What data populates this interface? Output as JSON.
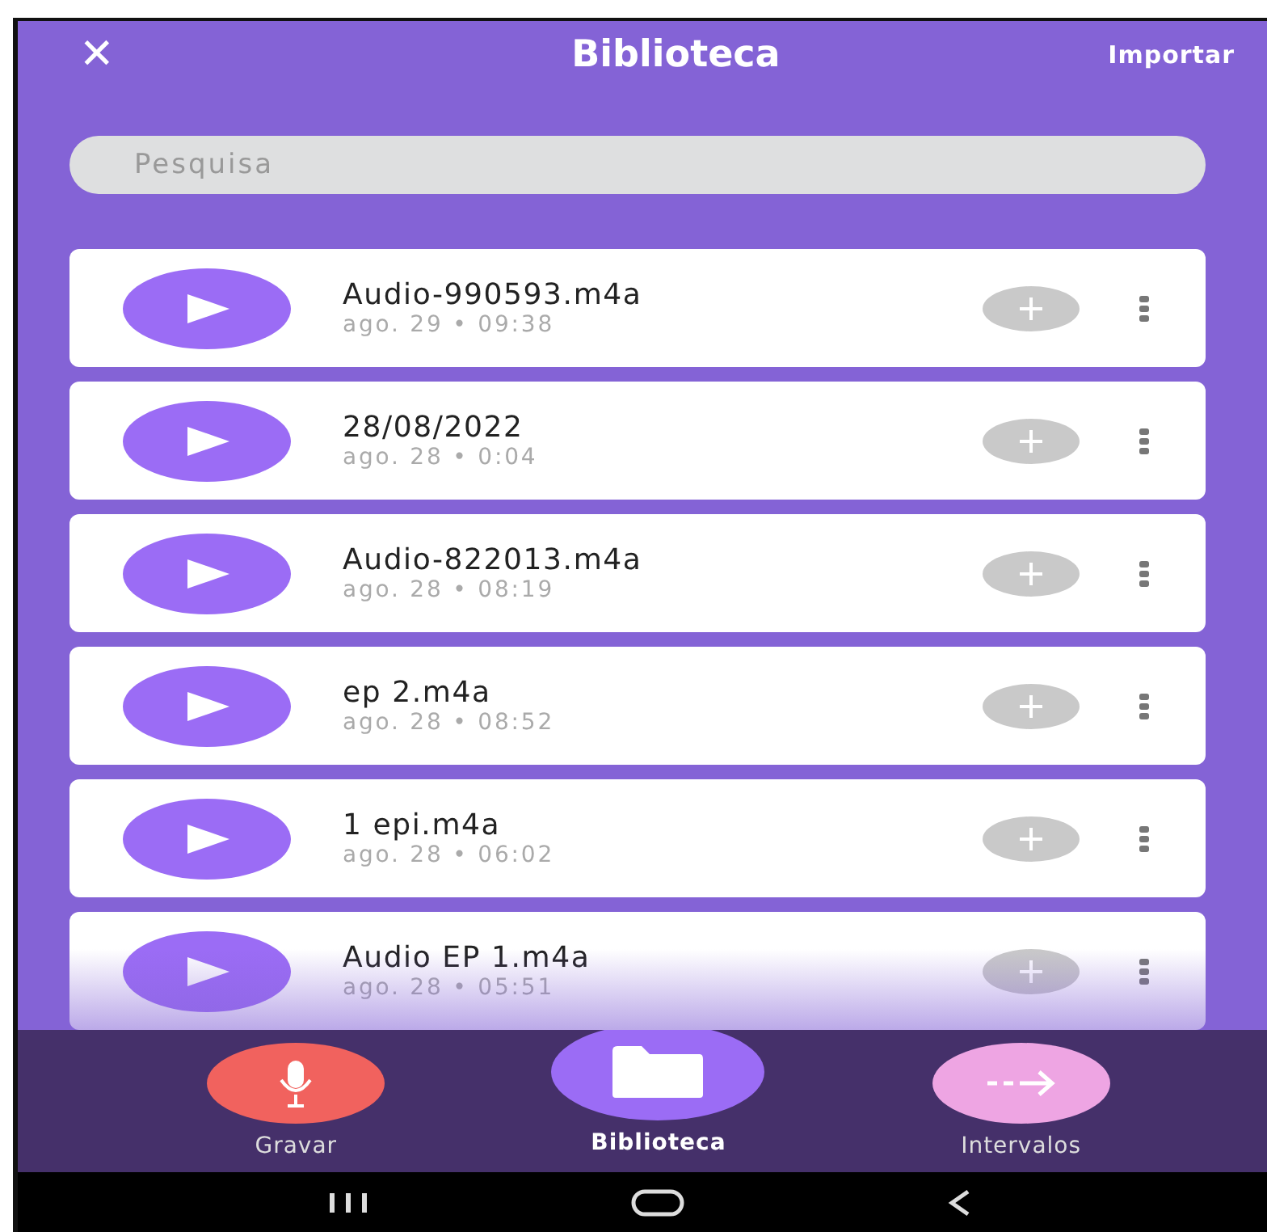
{
  "header": {
    "close": "✕",
    "title": "Biblioteca",
    "action": "Importar"
  },
  "search": {
    "placeholder": "Pesquisa"
  },
  "recordings": [
    {
      "name": "Audio-990593.m4a",
      "date": "ago. 29 • 09:38"
    },
    {
      "name": "28/08/2022",
      "date": "ago. 28 • 0:04"
    },
    {
      "name": "Audio-822013.m4a",
      "date": "ago. 28 • 08:19"
    },
    {
      "name": "ep 2.m4a",
      "date": "ago. 28 • 08:52"
    },
    {
      "name": "1 epi.m4a",
      "date": "ago. 28 • 06:02"
    },
    {
      "name": "Audio EP 1.m4a",
      "date": "ago. 28 • 05:51"
    }
  ],
  "bottom_nav": [
    {
      "kind": "record",
      "label": "Gravar",
      "selected": false
    },
    {
      "kind": "library",
      "label": "Biblioteca",
      "selected": true
    },
    {
      "kind": "intervals",
      "label": "Intervalos",
      "selected": false
    }
  ]
}
